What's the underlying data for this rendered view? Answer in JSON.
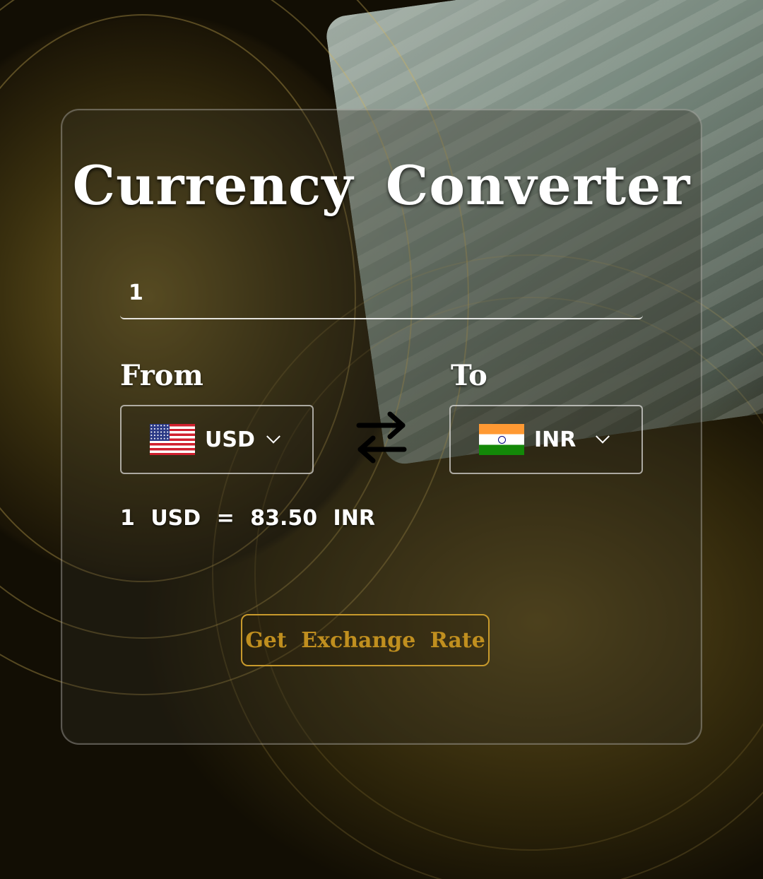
{
  "app": {
    "title": "Currency Converter"
  },
  "amount": {
    "value": "1"
  },
  "from": {
    "label": "From",
    "currency": "USD",
    "flag_icon": "us-flag-icon"
  },
  "to": {
    "label": "To",
    "currency": "INR",
    "flag_icon": "india-flag-icon"
  },
  "swap": {
    "icon": "swap-arrows-icon"
  },
  "result": {
    "text": "1 USD = 83.50 INR"
  },
  "button": {
    "label": "Get Exchange Rate"
  },
  "colors": {
    "accent": "#c89a2c",
    "text": "#ffffff"
  }
}
